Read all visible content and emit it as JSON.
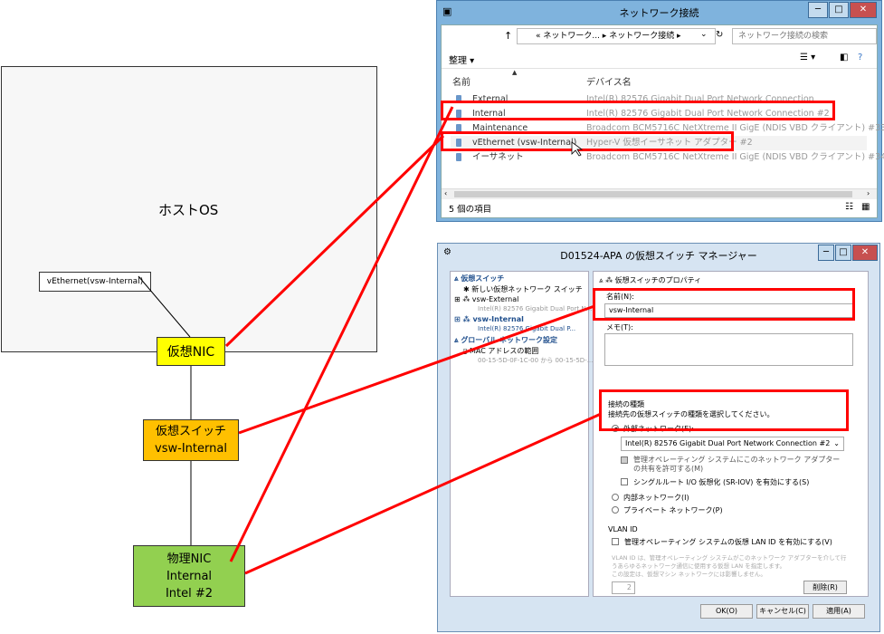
{
  "diagram": {
    "host_label": "ホストOS",
    "vethernet_label": "vEthernet(vsw-Internal)",
    "vnic_label": "仮想NIC",
    "vswitch_line1": "仮想スイッチ",
    "vswitch_line2": "vsw-Internal",
    "pnic_line1": "物理NIC",
    "pnic_line2": "Internal",
    "pnic_line3": "Intel #2"
  },
  "net_window": {
    "title": "ネットワーク接続",
    "breadcrumb": "« ネットワーク... ▸ ネットワーク接続 ▸",
    "search_placeholder": "ネットワーク接続の検索",
    "organize": "整理 ▾",
    "col_name": "名前",
    "col_device": "デバイス名",
    "rows": [
      {
        "name": "External",
        "device": "Intel(R) 82576 Gigabit Dual Port Network Connection"
      },
      {
        "name": "Internal",
        "device": "Intel(R) 82576 Gigabit Dual Port Network Connection #2"
      },
      {
        "name": "Maintenance",
        "device": "Broadcom BCM5716C NetXtreme II GigE (NDIS VBD クライアント) #33"
      },
      {
        "name": "vEthernet (vsw-Internal)",
        "device": "Hyper-V 仮想イーサネット アダプター #2"
      },
      {
        "name": "イーサネット",
        "device": "Broadcom BCM5716C NetXtreme II GigE (NDIS VBD クライアント) #34"
      }
    ],
    "status": "5 個の項目"
  },
  "vsm_window": {
    "title": "D01524-APA の仮想スイッチ マネージャー",
    "tree": {
      "header": "仮想スイッチ",
      "new_switch": "新しい仮想ネットワーク スイッチ",
      "external_name": "vsw-External",
      "external_sub": "Intel(R) 82576 Gigabit Dual Port N...",
      "internal_name": "vsw-Internal",
      "internal_sub": "Intel(R) 82576 Gigabit Dual P...",
      "global_header": "グローバル ネットワーク設定",
      "mac_range": "MAC アドレスの範囲",
      "mac_sub": "00-15-5D-0F-1C-00 から 00-15-5D-..."
    },
    "props": {
      "header": "仮想スイッチのプロパティ",
      "name_label": "名前(N):",
      "name_value": "vsw-Internal",
      "notes_label": "メモ(T):",
      "conn_type_label": "接続の種類",
      "conn_type_desc": "接続先の仮想スイッチの種類を選択してください。",
      "external_network": "外部ネットワーク(E):",
      "adapter_value": "Intel(R) 82576 Gigabit Dual Port Network Connection #2",
      "allow_mgmt": "管理オペレーティング システムにこのネットワーク アダプターの共有を許可する(M)",
      "sriov": "シングルルート I/O 仮想化 (SR-IOV) を有効にする(S)",
      "internal_network": "内部ネットワーク(I)",
      "private_network": "プライベート ネットワーク(P)",
      "vlan_header": "VLAN ID",
      "vlan_enable": "管理オペレーティング システムの仮想 LAN ID を有効にする(V)",
      "vlan_desc1": "VLAN ID は、管理オペレーティング システムがこのネットワーク アダプターを介して行",
      "vlan_desc2": "うあらゆるネットワーク通信に使用する仮想 LAN を指定します。",
      "vlan_desc3": "この設定は、仮想マシン ネットワークには影響しません。",
      "vlan_value": "2",
      "delete_button": "削除(R)"
    },
    "buttons": {
      "ok": "OK(O)",
      "cancel": "キャンセル(C)",
      "apply": "適用(A)"
    }
  },
  "colors": {
    "vnic": "#ffff00",
    "vswitch": "#ffc000",
    "pnic": "#92d050",
    "highlight": "#ff0000"
  }
}
